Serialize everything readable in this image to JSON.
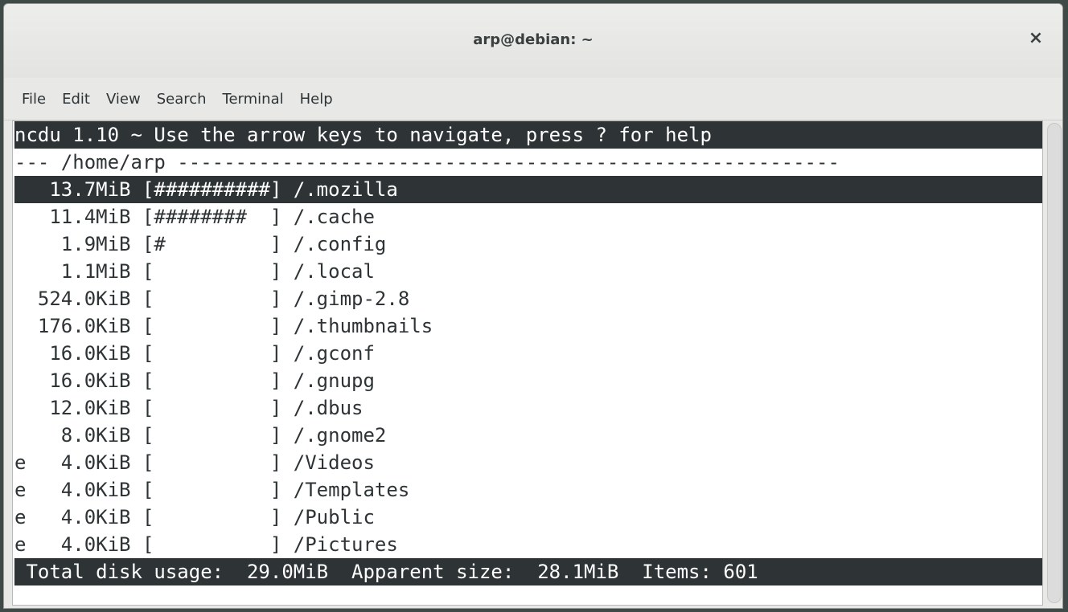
{
  "window": {
    "title": "arp@debian: ~",
    "close_glyph": "×"
  },
  "menu": [
    "File",
    "Edit",
    "View",
    "Search",
    "Terminal",
    "Help"
  ],
  "ncdu": {
    "header": "ncdu 1.10 ~ Use the arrow keys to navigate, press ? for help",
    "path_line": "--- /home/arp ---------------------------------------------------------",
    "rows": [
      "   13.7MiB [##########] /.mozilla",
      "   11.4MiB [########  ] /.cache",
      "    1.9MiB [#         ] /.config",
      "    1.1MiB [          ] /.local",
      "  524.0KiB [          ] /.gimp-2.8",
      "  176.0KiB [          ] /.thumbnails",
      "   16.0KiB [          ] /.gconf",
      "   16.0KiB [          ] /.gnupg",
      "   12.0KiB [          ] /.dbus",
      "    8.0KiB [          ] /.gnome2",
      "e   4.0KiB [          ] /Videos",
      "e   4.0KiB [          ] /Templates",
      "e   4.0KiB [          ] /Public",
      "e   4.0KiB [          ] /Pictures"
    ],
    "footer": " Total disk usage:  29.0MiB  Apparent size:  28.1MiB  Items: 601"
  },
  "colors": {
    "terminal_bg": "#ffffff",
    "terminal_fg": "#2e3436",
    "inverse_bg": "#2e3436",
    "inverse_fg": "#ffffff"
  }
}
